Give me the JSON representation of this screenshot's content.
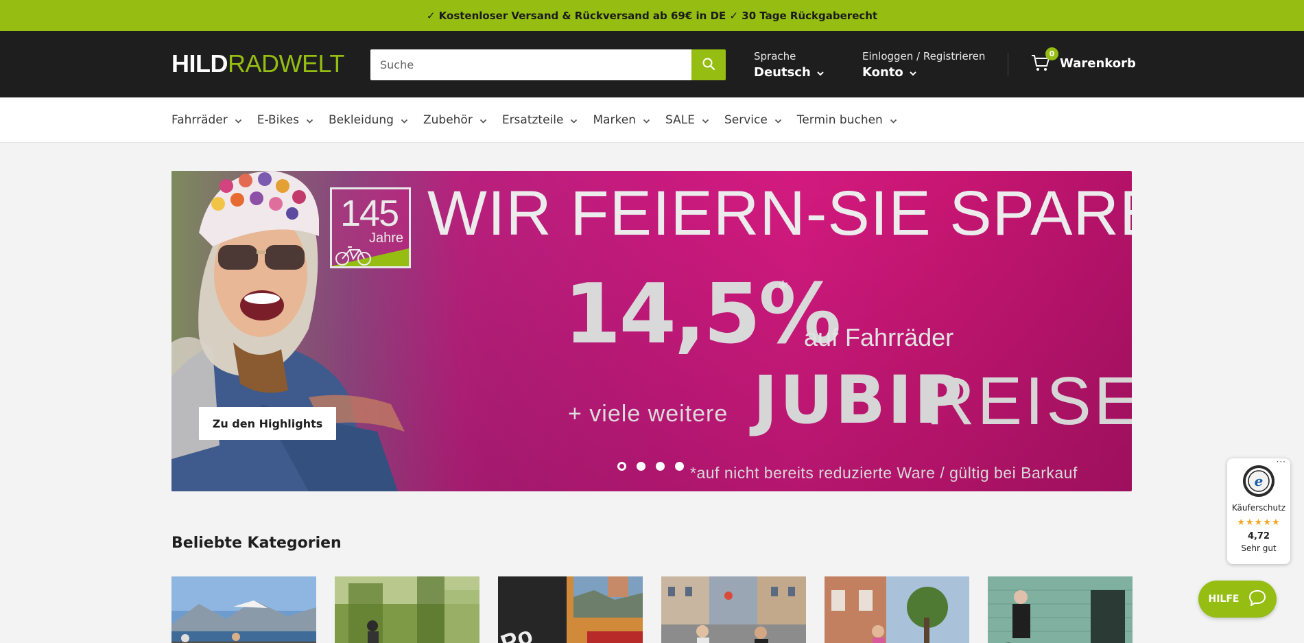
{
  "announcement": "✓ Kostenloser Versand & Rückversand ab 69€ in DE ✓ 30 Tage Rückgaberecht",
  "brand": {
    "part1": "HILD",
    "part2": "RADWELT",
    "accent_color": "#95bd12",
    "header_bg": "#1e1e1e"
  },
  "search": {
    "placeholder": "Suche",
    "value": "",
    "icon": "search-icon"
  },
  "language": {
    "label": "Sprache",
    "value": "Deutsch"
  },
  "account": {
    "label": "Einloggen / Registrieren",
    "value": "Konto"
  },
  "cart": {
    "label": "Warenkorb",
    "count": "0",
    "icon": "cart-icon"
  },
  "nav": {
    "items": [
      {
        "label": "Fahrräder"
      },
      {
        "label": "E-Bikes"
      },
      {
        "label": "Bekleidung"
      },
      {
        "label": "Zubehör"
      },
      {
        "label": "Ersatzteile"
      },
      {
        "label": "Marken"
      },
      {
        "label": "SALE"
      },
      {
        "label": "Service"
      },
      {
        "label": "Termin buchen"
      }
    ]
  },
  "hero": {
    "badge_number": "145",
    "badge_label": "Jahre",
    "headline": "WIR FEIERN-SIE SPAREN",
    "percent": "14,5%",
    "asterisk": "*",
    "percent_suffix": "auf Fahrräder",
    "more_text": "+ viele weitere",
    "jubi_bold": "JUBIP",
    "jubi_light": "REISE",
    "disclaimer": "*auf nicht bereits reduzierte Ware / gültig bei Barkauf",
    "button": "Zu den Highlights",
    "slide_count": 4,
    "active_slide": 1
  },
  "categories": {
    "title": "Beliebte Kategorien"
  },
  "trust_badge": {
    "more": "···",
    "label": "Käuferschutz",
    "stars": "★★★★★",
    "score": "4,72",
    "verdict": "Sehr gut"
  },
  "help": {
    "label": "HILFE",
    "icon": "chat-bubble-icon"
  }
}
